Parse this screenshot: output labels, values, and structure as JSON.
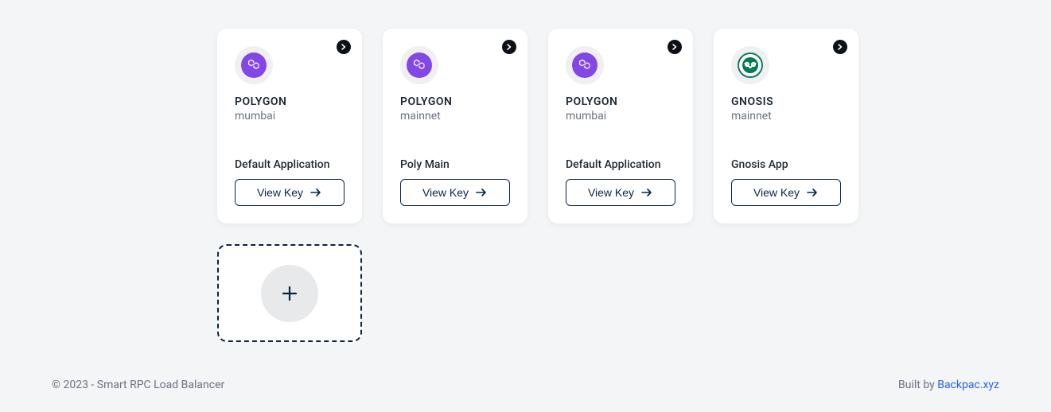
{
  "cards": [
    {
      "chain": "POLYGON",
      "network": "mumbai",
      "app": "Default Application",
      "icon": "polygon",
      "button": "View Key"
    },
    {
      "chain": "POLYGON",
      "network": "mainnet",
      "app": "Poly Main",
      "icon": "polygon",
      "button": "View Key"
    },
    {
      "chain": "POLYGON",
      "network": "mumbai",
      "app": "Default Application",
      "icon": "polygon",
      "button": "View Key"
    },
    {
      "chain": "GNOSIS",
      "network": "mainnet",
      "app": "Gnosis App",
      "icon": "gnosis",
      "button": "View Key"
    }
  ],
  "footer": {
    "left": "© 2023 - Smart RPC Load Balancer",
    "right_prefix": "Built by ",
    "right_link": "Backpac.xyz"
  }
}
